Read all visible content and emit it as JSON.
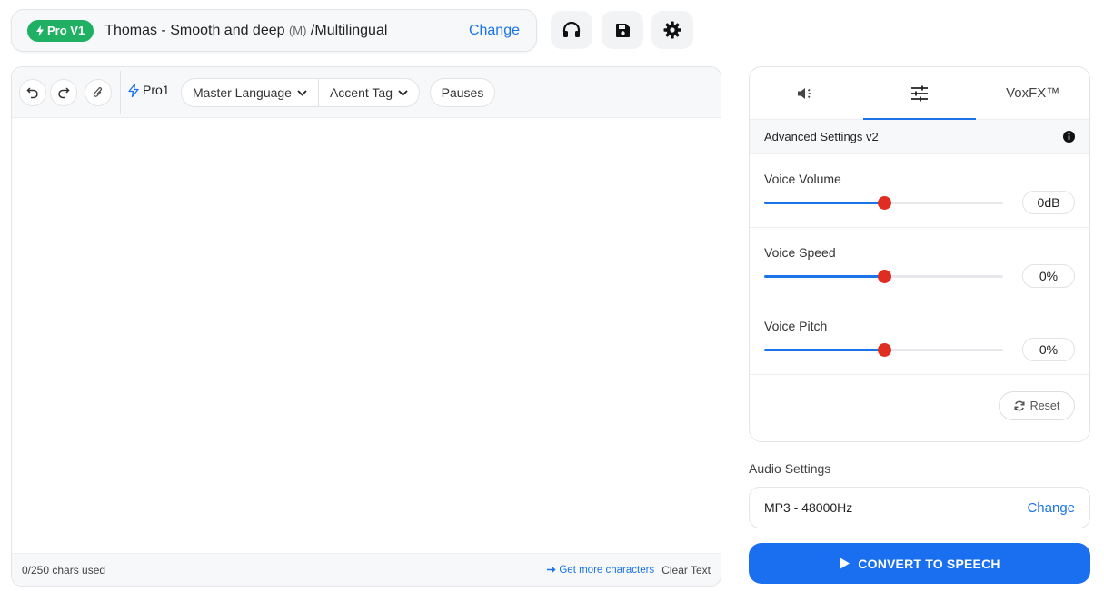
{
  "voice": {
    "badge": "Pro V1",
    "name": "Thomas - Smooth and deep ",
    "gender_tag": "(M)",
    "language": " /Multilingual",
    "change_label": "Change"
  },
  "toolbar": {
    "model": "Pro1",
    "master_language": "Master Language",
    "accent_tag": "Accent Tag",
    "pauses": "Pauses"
  },
  "editor": {
    "text": "",
    "chars_used": "0/250 chars used",
    "get_more": "Get more characters",
    "clear_text": "Clear Text"
  },
  "settings": {
    "tabs": [
      {
        "label": "",
        "icon": "speaker-icon"
      },
      {
        "label": "",
        "icon": "sliders-icon",
        "active": true
      },
      {
        "label": "VoxFX™"
      }
    ],
    "header": "Advanced Settings v2",
    "sliders": [
      {
        "label": "Voice Volume",
        "value": "0dB",
        "fraction": 0.5
      },
      {
        "label": "Voice Speed",
        "value": "0%",
        "fraction": 0.5
      },
      {
        "label": "Voice Pitch",
        "value": "0%",
        "fraction": 0.5
      }
    ],
    "reset_label": "Reset"
  },
  "audio": {
    "label": "Audio Settings",
    "format": "MP3 - 48000Hz",
    "change_label": "Change"
  },
  "convert_label": "CONVERT TO SPEECH",
  "colors": {
    "accent": "#1a73e8",
    "badge_green": "#1fb064",
    "slider_thumb": "#e02d22"
  }
}
